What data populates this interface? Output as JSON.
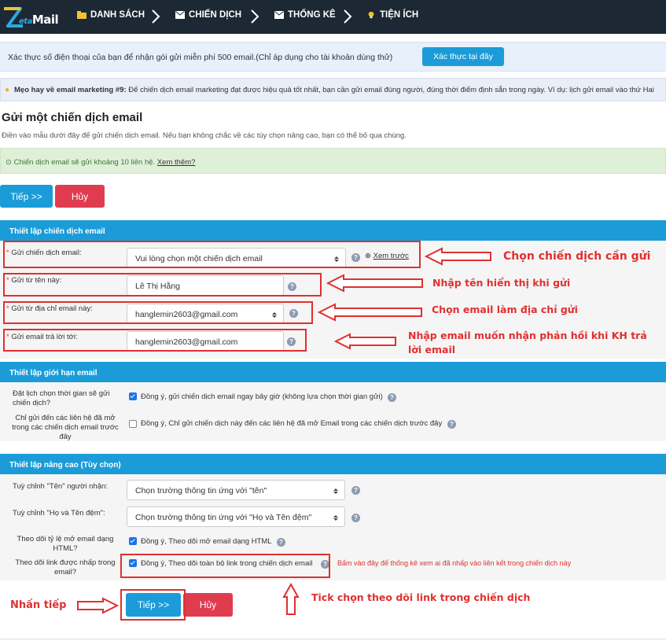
{
  "nav": {
    "logo_prefix": "eta",
    "logo_suffix": "Mail",
    "items": [
      {
        "label": "DANH SÁCH",
        "icon": "list-folder-icon"
      },
      {
        "label": "CHIẾN DỊCH",
        "icon": "envelope-icon"
      },
      {
        "label": "THỐNG KÊ",
        "icon": "envelope-icon"
      },
      {
        "label": "TIỆN ÍCH",
        "icon": "lightbulb-icon"
      }
    ]
  },
  "verify": {
    "text": "Xác thực số điện thoại của bạn để nhận gói gửi miễn phí 500 email.(Chỉ áp dụng cho tài khoản dùng thử)",
    "button": "Xác thực tại đây"
  },
  "tip": {
    "title": "Mẹo hay về email marketing #9:",
    "text": "Để chiến dịch email marketing đạt được hiệu quả tốt nhất, bạn cần gửi email đúng người, đúng thời điểm định sẵn trong ngày. Ví dụ: lịch gửi email vào thứ Hai"
  },
  "page": {
    "title": "Gửi một chiến dịch email",
    "subtitle": "Điền vào mẫu dưới đây để gửi chiến dịch email. Nếu bạn không chắc về các tùy chọn nâng cao, bạn có thể bỏ qua chúng."
  },
  "notice": {
    "text": "Chiến dịch email sẽ gửi khoảng 10 liên hệ.",
    "link": "Xem thêm?"
  },
  "buttons": {
    "next": "Tiếp >>",
    "cancel": "Hủy"
  },
  "section1": {
    "title": "Thiết lập chiến dịch email",
    "campaign_label": "Gửi chiến dịch email:",
    "campaign_value": "Vui lòng chọn một chiến dịch email",
    "preview": "Xem trước",
    "from_name_label": "Gửi từ tên này:",
    "from_name_value": "Lê Thị Hằng",
    "from_email_label": "Gửi từ địa chỉ email này:",
    "from_email_value": "hanglemin2603@gmail.com",
    "reply_label": "Gửi email trả lời tới:",
    "reply_value": "hanglemin2603@gmail.com"
  },
  "section2": {
    "title": "Thiết lập giới hạn email",
    "schedule_label_1": "Đặt lịch chọn thời gian sẽ gửi",
    "schedule_label_2": "chiến dịch?",
    "schedule_text": "Đồng ý, gửi chiến dịch email ngay bây giờ (không lựa chọn thời gian gửi)",
    "schedule_checked": true,
    "opened_label_1": "Chỉ gửi đến các liên hệ đã mở",
    "opened_label_2": "trong các chiến dịch email trước",
    "opened_label_3": "đây",
    "opened_text": "Đồng ý, Chỉ gửi chiến dịch này đến các liên hệ đã mở Email trong các chiến dịch trước đây",
    "opened_checked": false
  },
  "section3": {
    "title": "Thiết lập nâng cao (Tùy chọn)",
    "name_label": "Tuỳ chỉnh \"Tên\" người nhận:",
    "name_value": "Chọn trường thông tin ứng với \"tên\"",
    "fullname_label": "Tuỳ chỉnh \"Họ và Tên đệm\":",
    "fullname_value": "Chọn trường thông tin ứng với \"Họ và Tên đệm\"",
    "openrate_label_1": "Theo dõi tỷ lệ mở email dạng",
    "openrate_label_2": "HTML?",
    "openrate_text": "Đồng ý, Theo dõi mở email dạng HTML",
    "openrate_checked": true,
    "link_label_1": "Theo dõi link được nhấp trong",
    "link_label_2": "email?",
    "link_text": "Đồng ý, Theo dõi toàn bộ link trong chiến dịch email",
    "link_checked": true,
    "link_note": "Bấm vào đây để thống kê xem ai đã nhấp vào liên kết trong chiến dịch này"
  },
  "annotations": {
    "choose_campaign": "Chọn chiến dịch cần gửi",
    "enter_name": "Nhập tên hiển thị khi gửi",
    "choose_email": "Chọn email làm địa chỉ gửi",
    "reply_1": "Nhập email muốn nhận phản hồi khi KH trả",
    "reply_2": "lời email",
    "press_next": "Nhấn tiếp",
    "tick_link": "Tick chọn theo dõi link trong chiến dịch"
  },
  "colors": {
    "nav_bg": "#1c2833",
    "accent": "#1b9cd8",
    "danger": "#e03c50",
    "annotation": "#e03030"
  }
}
